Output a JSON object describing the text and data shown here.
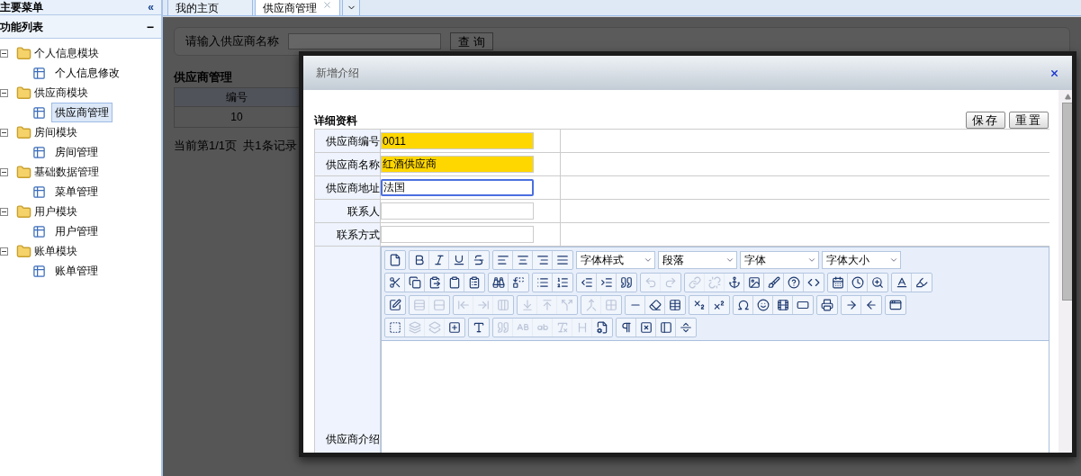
{
  "sidebar": {
    "title": "主要菜单",
    "collapse_glyph": "«",
    "section": {
      "title": "功能列表",
      "toggle_glyph": "−"
    },
    "tree": [
      {
        "label": "个人信息模块",
        "expanded": true,
        "children": [
          {
            "label": "个人信息修改",
            "selected": false
          }
        ]
      },
      {
        "label": "供应商模块",
        "expanded": true,
        "children": [
          {
            "label": "供应商管理",
            "selected": true
          }
        ]
      },
      {
        "label": "房间模块",
        "expanded": true,
        "children": [
          {
            "label": "房间管理",
            "selected": false
          }
        ]
      },
      {
        "label": "基础数据管理",
        "expanded": true,
        "children": [
          {
            "label": "菜单管理",
            "selected": false
          }
        ]
      },
      {
        "label": "用户模块",
        "expanded": true,
        "children": [
          {
            "label": "用户管理",
            "selected": false
          }
        ]
      },
      {
        "label": "账单模块",
        "expanded": true,
        "children": [
          {
            "label": "账单管理",
            "selected": false
          }
        ]
      }
    ]
  },
  "tabs": [
    {
      "label": "我的主页",
      "selected": false,
      "closable": false
    },
    {
      "label": "供应商管理",
      "selected": true,
      "closable": true
    }
  ],
  "page": {
    "search_label": "请输入供应商名称",
    "search_button": "查 询",
    "heading": "供应商管理",
    "table": {
      "columns": [
        "编号"
      ],
      "rows": [
        [
          "10"
        ]
      ]
    },
    "pagination": "当前第1/1页  共1条记录"
  },
  "dialog": {
    "title": "新增介绍",
    "section": "详细资料",
    "buttons": [
      "保存",
      "重置"
    ],
    "fields": [
      {
        "label": "供应商编号",
        "value": "0011",
        "highlighted": true,
        "focused": false
      },
      {
        "label": "供应商名称",
        "value": "红酒供应商",
        "highlighted": true,
        "focused": false
      },
      {
        "label": "供应商地址",
        "value": "法国",
        "highlighted": false,
        "focused": true
      },
      {
        "label": "联系人",
        "highlighted": false,
        "focused": false
      },
      {
        "label": "联系方式",
        "highlighted": false,
        "focused": false
      }
    ],
    "editor": {
      "label": "供应商介绍",
      "selects": [
        "字体样式",
        "段落",
        "字体",
        "字体大小"
      ],
      "toolbar": [
        [
          [
            {
              "disabled": false
            }
          ],
          [
            {
              "disabled": false
            },
            {
              "disabled": false
            },
            {
              "disabled": false
            },
            {
              "disabled": false
            }
          ],
          [
            {
              "disabled": false
            },
            {
              "disabled": false
            },
            {
              "disabled": false
            },
            {
              "disabled": false
            }
          ]
        ],
        [
          [
            {
              "disabled": false
            },
            {
              "disabled": false
            },
            {
              "disabled": false
            },
            {
              "disabled": false
            },
            {
              "disabled": false
            }
          ],
          [
            {
              "disabled": false
            },
            {
              "disabled": false
            }
          ],
          [
            {
              "disabled": false
            },
            {
              "disabled": false
            }
          ],
          [
            {
              "disabled": false
            },
            {
              "disabled": false
            },
            {
              "disabled": false
            }
          ],
          [
            {
              "disabled": true
            },
            {
              "disabled": true
            }
          ],
          [
            {
              "disabled": true
            },
            {
              "disabled": true
            },
            {
              "disabled": false
            },
            {
              "disabled": false
            },
            {
              "disabled": false
            },
            {
              "disabled": false
            },
            {
              "disabled": false
            }
          ],
          [
            {
              "disabled": false
            },
            {
              "disabled": false
            },
            {
              "disabled": false
            }
          ],
          [
            {
              "disabled": false
            },
            {
              "disabled": false
            }
          ]
        ],
        [
          [
            {
              "disabled": false
            }
          ],
          [
            {
              "disabled": true
            },
            {
              "disabled": true
            }
          ],
          [
            {
              "disabled": true
            },
            {
              "disabled": true
            },
            {
              "disabled": true
            }
          ],
          [
            {
              "disabled": true
            },
            {
              "disabled": true
            },
            {
              "disabled": true
            }
          ],
          [
            {
              "disabled": true
            },
            {
              "disabled": true
            }
          ],
          [
            {
              "disabled": false
            },
            {
              "disabled": false
            },
            {
              "disabled": false
            }
          ],
          [
            {
              "disabled": false
            },
            {
              "disabled": false
            }
          ],
          [
            {
              "disabled": false
            },
            {
              "disabled": false
            },
            {
              "disabled": false
            },
            {
              "disabled": false
            }
          ],
          [
            {
              "disabled": false
            }
          ],
          [
            {
              "disabled": false
            },
            {
              "disabled": false
            }
          ],
          [
            {
              "disabled": false
            }
          ]
        ],
        [
          [
            {
              "disabled": false
            },
            {
              "disabled": true
            },
            {
              "disabled": true
            },
            {
              "disabled": false
            }
          ],
          [
            {
              "disabled": false
            }
          ],
          [
            {
              "disabled": true
            },
            {
              "disabled": true
            },
            {
              "disabled": true
            },
            {
              "disabled": true
            },
            {
              "disabled": true
            },
            {
              "disabled": false
            }
          ],
          [
            {
              "disabled": false
            },
            {
              "disabled": false
            },
            {
              "disabled": false
            },
            {
              "disabled": false
            }
          ]
        ]
      ]
    }
  }
}
